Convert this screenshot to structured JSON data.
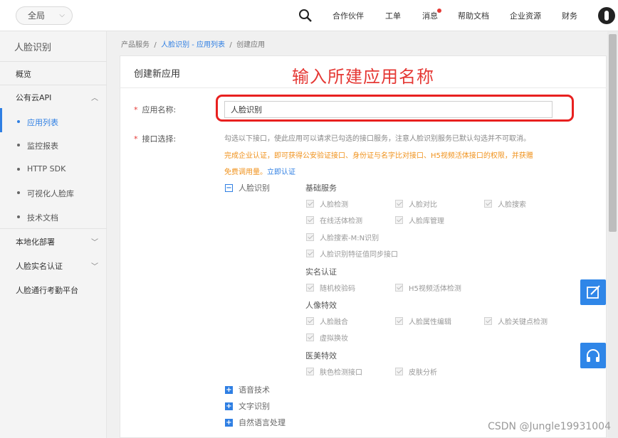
{
  "topbar": {
    "region": "全局",
    "nav": [
      "合作伙伴",
      "工单",
      "消息",
      "帮助文档",
      "企业资源",
      "财务"
    ]
  },
  "sidebar": {
    "title": "人脸识别",
    "overview": "概览",
    "public_api": "公有云API",
    "sub_items": [
      "应用列表",
      "监控报表",
      "HTTP SDK",
      "可视化人脸库",
      "技术文档"
    ],
    "local_deploy": "本地化部署",
    "realname": "人脸实名认证",
    "attendance": "人脸通行考勤平台"
  },
  "breadcrumb": {
    "part1": "产品服务",
    "sep": "/",
    "part2": "人脸识别 - 应用列表",
    "part3": "创建应用"
  },
  "panel": {
    "title": "创建新应用",
    "annotation": "输入所建应用名称"
  },
  "form": {
    "name_label": "应用名称:",
    "name_value": "人脸识别",
    "api_label": "接口选择:",
    "required_mark": "*",
    "desc1": "勾选以下接口，使此应用可以请求已勾选的接口服务，注意人脸识别服务已默认勾选并不可取消。",
    "desc2": "完成企业认证，即可获得公安验证接口、身份证与名字比对接口、H5视频活体接口的权限，并获赠",
    "desc3_text": "免费调用量。",
    "desc3_link": "立即认证"
  },
  "tree": {
    "root": "人脸识别",
    "root_symbol": "−",
    "collapsed_symbol": "+",
    "groups": [
      {
        "name": "基础服务",
        "items": [
          "人脸检测",
          "人脸对比",
          "人脸搜索",
          "在线活体检测",
          "人脸库管理",
          "人脸搜索-M:N识别",
          "人脸识别特征值同步接口"
        ]
      },
      {
        "name": "实名认证",
        "items": [
          "随机校验码",
          "H5视频活体检测"
        ]
      },
      {
        "name": "人像特效",
        "items": [
          "人脸融合",
          "人脸属性编辑",
          "人脸关键点检测",
          "虚拟换妆"
        ]
      },
      {
        "name": "医美特效",
        "items": [
          "肤色检测接口",
          "皮肤分析"
        ]
      }
    ],
    "collapsed": [
      "语音技术",
      "文字识别",
      "自然语言处理"
    ]
  },
  "watermark": "CSDN @Jungle19931004",
  "colors": {
    "accent": "#2f7fe3",
    "highlight": "#e8201f",
    "warning": "#f0921c"
  },
  "icons": {
    "search": "magnifier",
    "edit": "edit-icon",
    "support": "headset-icon"
  }
}
